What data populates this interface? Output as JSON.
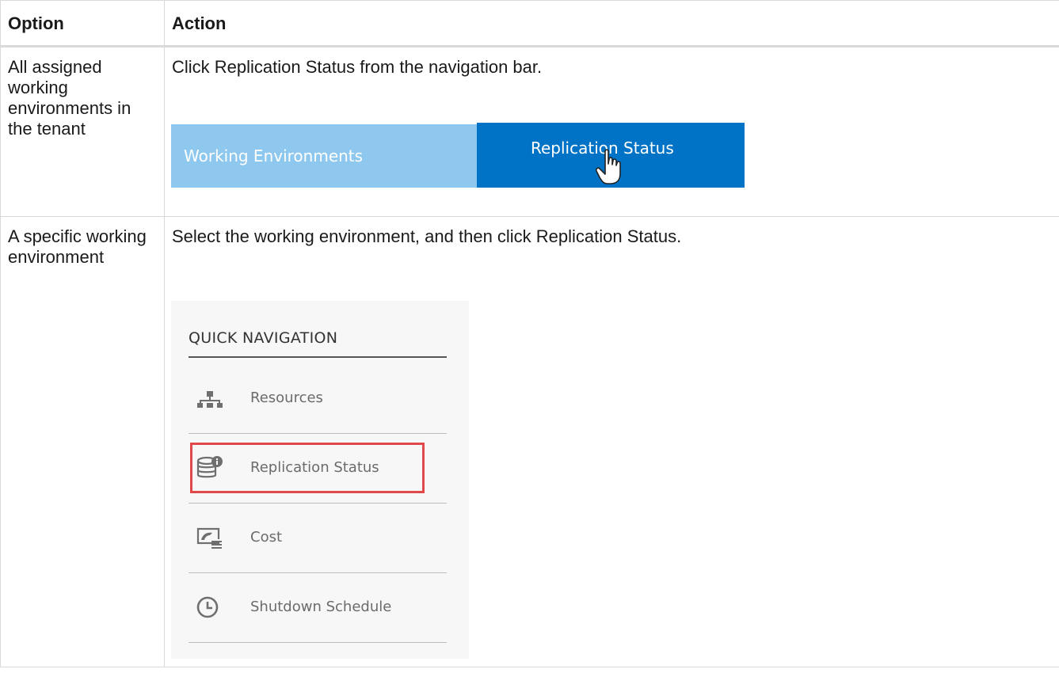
{
  "table": {
    "header": {
      "option": "Option",
      "action": "Action"
    },
    "rows": [
      {
        "option": "All assigned working environments in the tenant",
        "action": "Click Replication Status from the navigation bar."
      },
      {
        "option": "A specific working environment",
        "action": "Select the working environment, and then click Replication Status."
      }
    ]
  },
  "navbar": {
    "tab_working_environments": "Working Environments",
    "tab_replication_status": "Replication Status",
    "colors": {
      "inactive": "#8fc8ee",
      "active": "#0073c6"
    },
    "cursor_icon": "hand-pointer-icon"
  },
  "quick_navigation": {
    "title": "QUICK NAVIGATION",
    "items": [
      {
        "label": "Resources",
        "icon": "hierarchy-icon"
      },
      {
        "label": "Replication Status",
        "icon": "database-info-icon",
        "highlighted": true
      },
      {
        "label": "Cost",
        "icon": "cost-report-icon"
      },
      {
        "label": "Shutdown Schedule",
        "icon": "clock-icon"
      }
    ],
    "highlight_color": "#e1484a"
  }
}
